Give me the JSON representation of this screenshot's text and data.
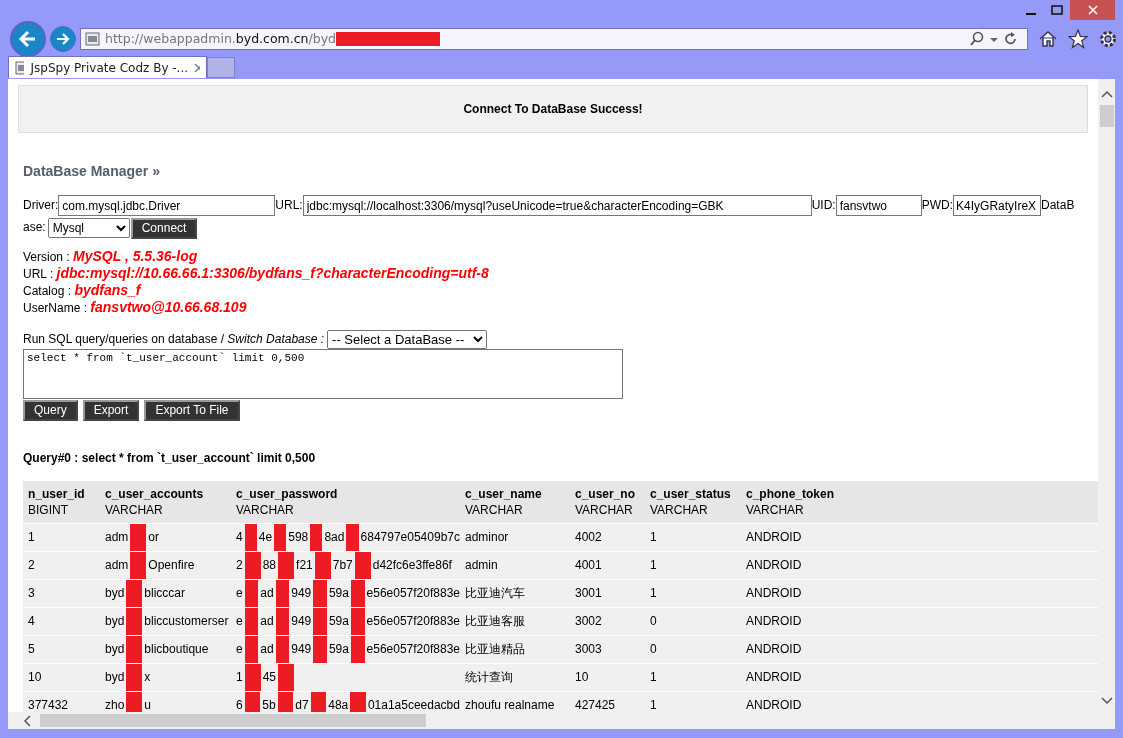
{
  "address_bar": {
    "prefix": "http://webappadmin.",
    "domain": "byd.com.cn",
    "path": "/byd",
    "redacted": true
  },
  "tabs": [
    {
      "label": "JspSpy Private Codz By -...",
      "selected": true
    }
  ],
  "notice": "Connect To DataBase Success!",
  "heading": "DataBase Manager »",
  "connection": {
    "driver_label": "Driver:",
    "driver": "com.mysql.jdbc.Driver",
    "url_label": "URL:",
    "url": "jdbc:mysql://localhost:3306/mysql?useUnicode=true&characterEncoding=GBK",
    "uid_label": "UID:",
    "uid": "fansvtwo",
    "pwd_label": "PWD:",
    "pwd": "K4IyGRatyIreX",
    "database_label_lines": [
      "DataB",
      "ase:"
    ],
    "database": "Mysql",
    "connect_button": "Connect"
  },
  "info": [
    {
      "label": "Version :",
      "value": "MySQL , 5.5.36-log"
    },
    {
      "label": "URL :",
      "value": "jdbc:mysql://10.66.66.1:3306/bydfans_f?characterEncoding=utf-8"
    },
    {
      "label": "Catalog :",
      "value": "bydfans_f"
    },
    {
      "label": "UserName :",
      "value": "fansvtwo@10.66.68.109"
    }
  ],
  "sql": {
    "prompt": "Run SQL query/queries on database / *Switch Database :*",
    "switch_select": "-- Select a DataBase --",
    "query": "select * from `t_user_account` limit 0,500",
    "buttons": [
      "Query",
      "Export",
      "Export To File"
    ]
  },
  "result_title": "Query#0 : select * from `t_user_account` limit 0,500",
  "table": {
    "columns": [
      {
        "name": "n_user_id",
        "type": "BIGINT"
      },
      {
        "name": "c_user_accounts",
        "type": "VARCHAR"
      },
      {
        "name": "c_user_password",
        "type": "VARCHAR"
      },
      {
        "name": "c_user_name",
        "type": "VARCHAR"
      },
      {
        "name": "c_user_no",
        "type": "VARCHAR"
      },
      {
        "name": "c_user_status",
        "type": "VARCHAR"
      },
      {
        "name": "c_phone_token",
        "type": "VARCHAR"
      }
    ],
    "rows": [
      [
        [
          {
            "kind": "text",
            "text": "1"
          }
        ],
        [
          {
            "kind": "text",
            "text": "adm"
          },
          {
            "kind": "redacted"
          },
          {
            "kind": "text",
            "text": "or"
          }
        ],
        [
          {
            "kind": "text",
            "text": "4"
          },
          {
            "kind": "redacted"
          },
          {
            "kind": "text",
            "text": "4e"
          },
          {
            "kind": "redacted"
          },
          {
            "kind": "text",
            "text": "598"
          },
          {
            "kind": "redacted"
          },
          {
            "kind": "text",
            "text": "8ad"
          },
          {
            "kind": "redacted"
          },
          {
            "kind": "text",
            "text": "684797e05409b7c"
          }
        ],
        [
          {
            "kind": "text",
            "text": "adminor"
          }
        ],
        [
          {
            "kind": "text",
            "text": "4002"
          }
        ],
        [
          {
            "kind": "text",
            "text": "1"
          }
        ],
        [
          {
            "kind": "text",
            "text": "ANDROID"
          }
        ]
      ],
      [
        [
          {
            "kind": "text",
            "text": "2"
          }
        ],
        [
          {
            "kind": "text",
            "text": "adm"
          },
          {
            "kind": "redacted"
          },
          {
            "kind": "text",
            "text": "Openfire"
          }
        ],
        [
          {
            "kind": "text",
            "text": "2"
          },
          {
            "kind": "redacted"
          },
          {
            "kind": "text",
            "text": "88"
          },
          {
            "kind": "redacted"
          },
          {
            "kind": "text",
            "text": "f21"
          },
          {
            "kind": "redacted"
          },
          {
            "kind": "text",
            "text": "7b7"
          },
          {
            "kind": "redacted"
          },
          {
            "kind": "text",
            "text": "d42fc6e3ffe86f"
          }
        ],
        [
          {
            "kind": "text",
            "text": "admin"
          }
        ],
        [
          {
            "kind": "text",
            "text": "4001"
          }
        ],
        [
          {
            "kind": "text",
            "text": "1"
          }
        ],
        [
          {
            "kind": "text",
            "text": "ANDROID"
          }
        ]
      ],
      [
        [
          {
            "kind": "text",
            "text": "3"
          }
        ],
        [
          {
            "kind": "text",
            "text": "byd"
          },
          {
            "kind": "redacted"
          },
          {
            "kind": "text",
            "text": "blicccar"
          }
        ],
        [
          {
            "kind": "text",
            "text": "e"
          },
          {
            "kind": "redacted"
          },
          {
            "kind": "text",
            "text": "ad"
          },
          {
            "kind": "redacted"
          },
          {
            "kind": "text",
            "text": "949"
          },
          {
            "kind": "redacted"
          },
          {
            "kind": "text",
            "text": "59a"
          },
          {
            "kind": "redacted"
          },
          {
            "kind": "text",
            "text": "e56e057f20f883e"
          }
        ],
        [
          {
            "kind": "text",
            "text": "比亚迪汽车"
          }
        ],
        [
          {
            "kind": "text",
            "text": "3001"
          }
        ],
        [
          {
            "kind": "text",
            "text": "1"
          }
        ],
        [
          {
            "kind": "text",
            "text": "ANDROID"
          }
        ]
      ],
      [
        [
          {
            "kind": "text",
            "text": "4"
          }
        ],
        [
          {
            "kind": "text",
            "text": "byd"
          },
          {
            "kind": "redacted"
          },
          {
            "kind": "text",
            "text": "bliccustomerser"
          }
        ],
        [
          {
            "kind": "text",
            "text": "e"
          },
          {
            "kind": "redacted"
          },
          {
            "kind": "text",
            "text": "ad"
          },
          {
            "kind": "redacted"
          },
          {
            "kind": "text",
            "text": "949"
          },
          {
            "kind": "redacted"
          },
          {
            "kind": "text",
            "text": "59a"
          },
          {
            "kind": "redacted"
          },
          {
            "kind": "text",
            "text": "e56e057f20f883e"
          }
        ],
        [
          {
            "kind": "text",
            "text": "比亚迪客服"
          }
        ],
        [
          {
            "kind": "text",
            "text": "3002"
          }
        ],
        [
          {
            "kind": "text",
            "text": "0"
          }
        ],
        [
          {
            "kind": "text",
            "text": "ANDROID"
          }
        ]
      ],
      [
        [
          {
            "kind": "text",
            "text": "5"
          }
        ],
        [
          {
            "kind": "text",
            "text": "byd"
          },
          {
            "kind": "redacted"
          },
          {
            "kind": "text",
            "text": "blicboutique"
          }
        ],
        [
          {
            "kind": "text",
            "text": "e"
          },
          {
            "kind": "redacted"
          },
          {
            "kind": "text",
            "text": "ad"
          },
          {
            "kind": "redacted"
          },
          {
            "kind": "text",
            "text": "949"
          },
          {
            "kind": "redacted"
          },
          {
            "kind": "text",
            "text": "59a"
          },
          {
            "kind": "redacted"
          },
          {
            "kind": "text",
            "text": "e56e057f20f883e"
          }
        ],
        [
          {
            "kind": "text",
            "text": "比亚迪精品"
          }
        ],
        [
          {
            "kind": "text",
            "text": "3003"
          }
        ],
        [
          {
            "kind": "text",
            "text": "0"
          }
        ],
        [
          {
            "kind": "text",
            "text": "ANDROID"
          }
        ]
      ],
      [
        [
          {
            "kind": "text",
            "text": "10"
          }
        ],
        [
          {
            "kind": "text",
            "text": "byd"
          },
          {
            "kind": "redacted"
          },
          {
            "kind": "text",
            "text": "x"
          }
        ],
        [
          {
            "kind": "text",
            "text": "1"
          },
          {
            "kind": "redacted"
          },
          {
            "kind": "text",
            "text": "45"
          },
          {
            "kind": "redacted"
          }
        ],
        [
          {
            "kind": "text",
            "text": "统计查询"
          }
        ],
        [
          {
            "kind": "text",
            "text": "10"
          }
        ],
        [
          {
            "kind": "text",
            "text": "1"
          }
        ],
        [
          {
            "kind": "text",
            "text": "ANDROID"
          }
        ]
      ],
      [
        [
          {
            "kind": "text",
            "text": "377432"
          }
        ],
        [
          {
            "kind": "text",
            "text": "zho"
          },
          {
            "kind": "redacted"
          },
          {
            "kind": "text",
            "text": "u"
          }
        ],
        [
          {
            "kind": "text",
            "text": "6"
          },
          {
            "kind": "redacted"
          },
          {
            "kind": "text",
            "text": "5b"
          },
          {
            "kind": "redacted"
          },
          {
            "kind": "text",
            "text": "d7"
          },
          {
            "kind": "redacted"
          },
          {
            "kind": "text",
            "text": "48a"
          },
          {
            "kind": "redacted"
          },
          {
            "kind": "text",
            "text": "01a1a5ceedacbd"
          }
        ],
        [
          {
            "kind": "text",
            "text": "zhoufu realname"
          }
        ],
        [
          {
            "kind": "text",
            "text": "427425"
          }
        ],
        [
          {
            "kind": "text",
            "text": "1"
          }
        ],
        [
          {
            "kind": "text",
            "text": "ANDROID"
          }
        ]
      ]
    ]
  }
}
